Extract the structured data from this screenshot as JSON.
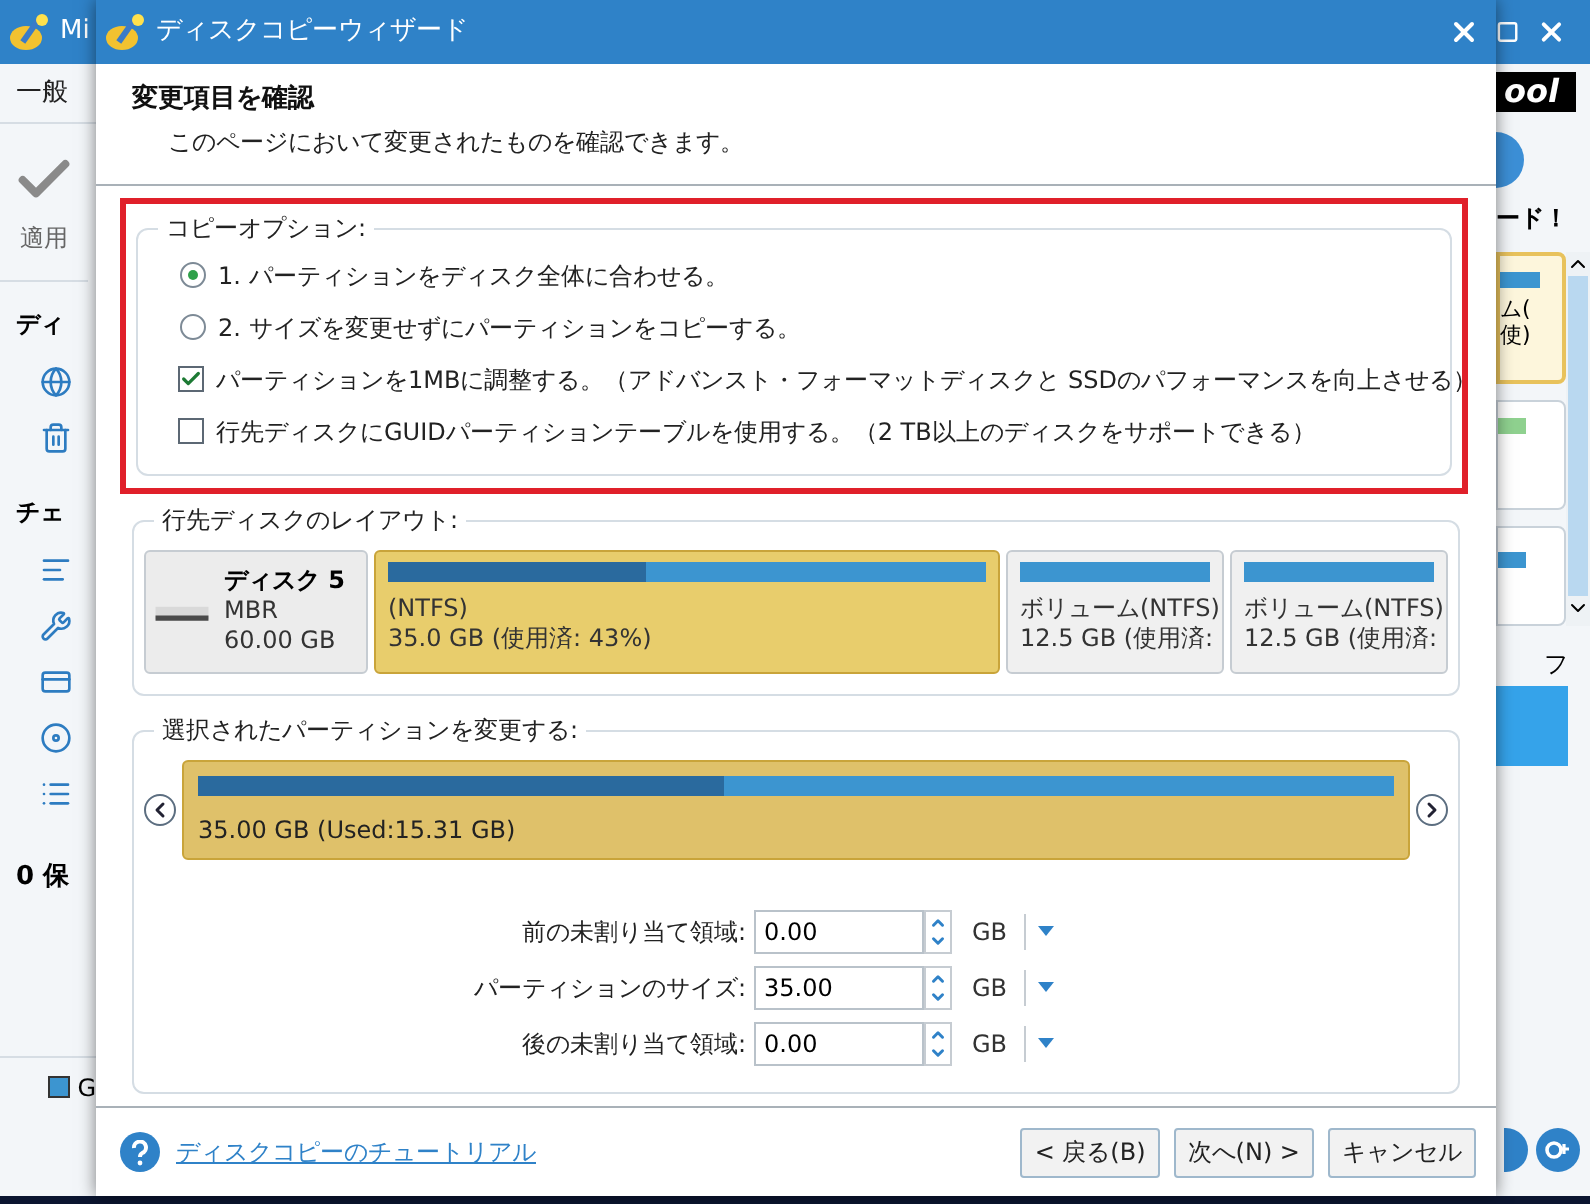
{
  "background_app": {
    "title": "Mi",
    "menu": "一般",
    "apply_label": "適用",
    "section_1": "ディ",
    "section_2": "チェ",
    "status": "0 保",
    "legend": "G",
    "logo": "ool",
    "banner": "ード！",
    "card_lines": [
      "ム(",
      "使)"
    ],
    "panel_label": "フ"
  },
  "dialog": {
    "title": "ディスクコピーウィザード",
    "heading": "変更項目を確認",
    "subheading": "このページにおいて変更されたものを確認できます。",
    "copy_options": {
      "legend": "コピーオプション:",
      "options": [
        {
          "kind": "radio",
          "label": "1. パーティションをディスク全体に合わせる。",
          "selected": true
        },
        {
          "kind": "radio",
          "label": "2. サイズを変更せずにパーティションをコピーする。",
          "selected": false
        },
        {
          "kind": "checkbox",
          "label": "パーティションを1MBに調整する。（アドバンスト・フォーマットディスクと SSDのパフォーマンスを向上させる）",
          "checked": true
        },
        {
          "kind": "checkbox",
          "label": "行先ディスクにGUIDパーティションテーブルを使用する。（2 TB以上のディスクをサポートできる）",
          "checked": false
        }
      ]
    },
    "layout": {
      "legend": "行先ディスクのレイアウト:",
      "disk": {
        "name": "ディスク 5",
        "type": "MBR",
        "size": "60.00 GB"
      },
      "partitions": [
        {
          "fs": "(NTFS)",
          "size": "35.0 GB (使用済: 43%)",
          "selected": true,
          "level": 0.43
        },
        {
          "fs": "ボリューム(NTFS)",
          "size": "12.5 GB (使用済:",
          "selected": false
        },
        {
          "fs": "ボリューム(NTFS)",
          "size": "12.5 GB (使用済:",
          "selected": false
        }
      ]
    },
    "edit": {
      "legend": "選択されたパーティションを変更する:",
      "bar_label": "35.00 GB (Used:15.31 GB)",
      "level": 0.44,
      "fields": [
        {
          "label": "前の未割り当て領域:",
          "value": "0.00",
          "unit": "GB"
        },
        {
          "label": "パーティションのサイズ:",
          "value": "35.00",
          "unit": "GB"
        },
        {
          "label": "後の未割り当て領域:",
          "value": "0.00",
          "unit": "GB"
        }
      ]
    },
    "tutorial_link": "ディスクコピーのチュートリアル",
    "buttons": [
      "< 戻る(B)",
      "次へ(N) >",
      "キャンセル"
    ]
  }
}
